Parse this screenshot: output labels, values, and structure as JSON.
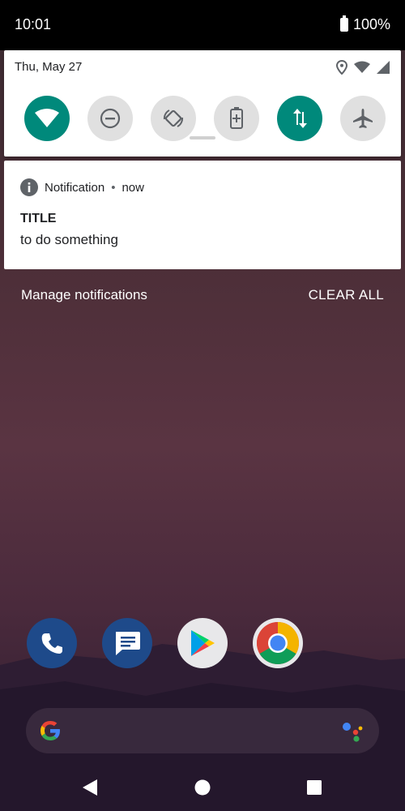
{
  "status_bar": {
    "time": "10:01",
    "battery_percent": "100%"
  },
  "quick_settings": {
    "date": "Thu, May 27",
    "tiles": [
      {
        "name": "wifi",
        "on": true
      },
      {
        "name": "do-not-disturb",
        "on": false
      },
      {
        "name": "auto-rotate",
        "on": false
      },
      {
        "name": "battery-saver",
        "on": false
      },
      {
        "name": "mobile-data",
        "on": true
      },
      {
        "name": "airplane-mode",
        "on": false
      }
    ],
    "accent_color": "#00897b"
  },
  "notification": {
    "app_name": "Notification",
    "separator": "•",
    "time": "now",
    "title": "TITLE",
    "body": "to do something"
  },
  "actions": {
    "manage": "Manage notifications",
    "clear_all": "CLEAR ALL"
  },
  "dock": {
    "apps": [
      "phone",
      "messages",
      "play-store",
      "chrome"
    ]
  },
  "nav": {
    "buttons": [
      "back",
      "home",
      "recents"
    ]
  }
}
